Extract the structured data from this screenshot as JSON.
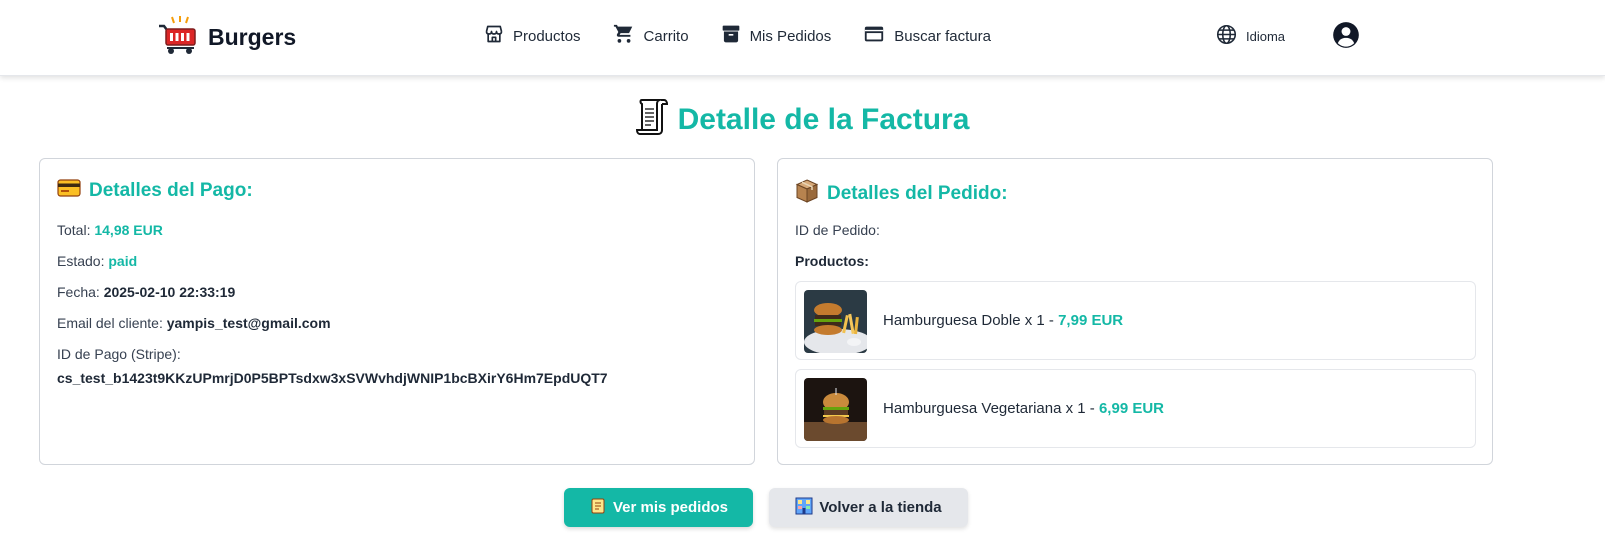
{
  "brand": {
    "name": "Burgers",
    "logo_icon": "shopping-cart-icon"
  },
  "nav": {
    "items": [
      {
        "label": "Productos",
        "icon": "store-icon"
      },
      {
        "label": "Carrito",
        "icon": "cart-icon"
      },
      {
        "label": "Mis Pedidos",
        "icon": "archive-icon"
      },
      {
        "label": "Buscar factura",
        "icon": "credit-card-icon"
      }
    ],
    "language_label": "Idioma",
    "user_icon": "user-circle-icon"
  },
  "page": {
    "title": "Detalle de la Factura",
    "title_icon": "receipt-scroll-icon"
  },
  "payment": {
    "heading": "Detalles del Pago:",
    "total_label": "Total:",
    "total_value": "14,98 EUR",
    "status_label": "Estado:",
    "status_value": "paid",
    "date_label": "Fecha:",
    "date_value": "2025-02-10 22:33:19",
    "email_label": "Email del cliente:",
    "email_value": "yampis_test@gmail.com",
    "stripe_label": "ID de Pago (Stripe):",
    "stripe_value": "cs_test_b1423t9KKzUPmrjD0P5BPTsdxw3xSVWvhdjWNIP1bcBXirY6Hm7EpdUQT7"
  },
  "order": {
    "heading": "Detalles del Pedido:",
    "id_label": "ID de Pedido:",
    "products_label": "Productos:",
    "products": [
      {
        "text": "Hamburguesa Doble x 1 - ",
        "price": "7,99 EUR"
      },
      {
        "text": "Hamburguesa Vegetariana x 1 - ",
        "price": "6,99 EUR"
      }
    ]
  },
  "actions": {
    "view_orders": "Ver mis pedidos",
    "back_to_store": "Volver a la tienda"
  },
  "colors": {
    "accent": "#14b8a6",
    "text": "#374151",
    "secondary_button": "#e5e7eb"
  }
}
